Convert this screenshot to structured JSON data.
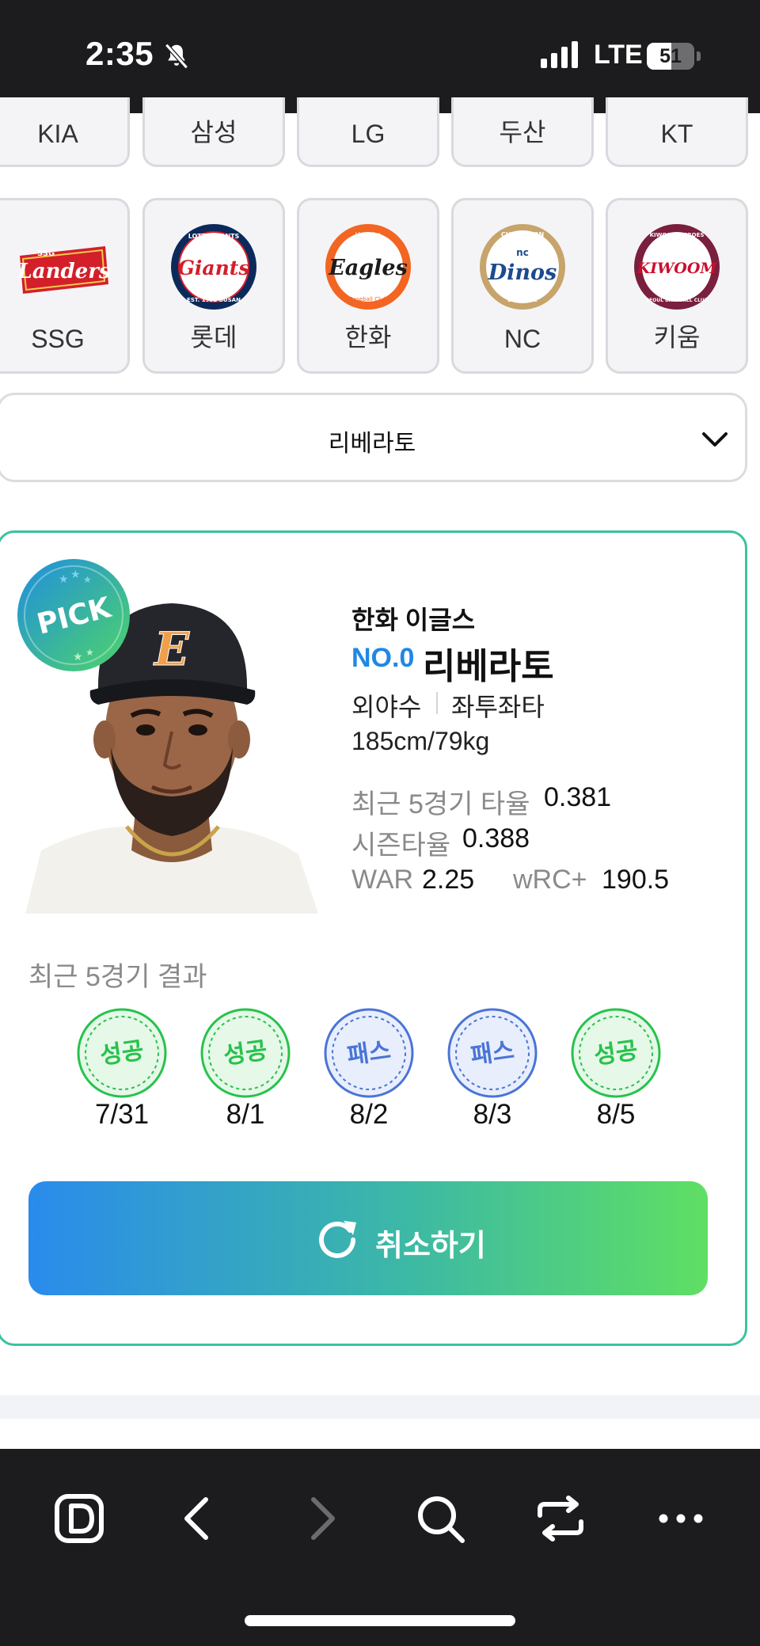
{
  "status_bar": {
    "time": "2:35",
    "network": "LTE",
    "battery": "51",
    "icons": [
      "bell-slash-icon",
      "signal-icon",
      "battery-icon"
    ]
  },
  "teams": {
    "row1": [
      "KIA",
      "삼성",
      "LG",
      "두산",
      "KT"
    ],
    "row2": [
      {
        "name": "SSG",
        "logo": "ssg-landers-logo",
        "logo_text": "Landers"
      },
      {
        "name": "롯데",
        "logo": "lotte-giants-logo",
        "logo_text": "Giants"
      },
      {
        "name": "한화",
        "logo": "hanwha-eagles-logo",
        "logo_text": "Eagles"
      },
      {
        "name": "NC",
        "logo": "nc-dinos-logo",
        "logo_text": "Dinos"
      },
      {
        "name": "키움",
        "logo": "kiwoom-heroes-logo",
        "logo_text": "KIWOOM"
      }
    ]
  },
  "player_select": {
    "value": "리베라토"
  },
  "player_card": {
    "badge": "PICK",
    "team": "한화 이글스",
    "number": "NO.0",
    "name": "리베라토",
    "position": "외야수",
    "handedness": "좌투좌타",
    "body": "185cm/79kg",
    "stats": {
      "recent5_label": "최근 5경기 타율",
      "recent5_value": "0.381",
      "season_label": "시즌타율",
      "season_value": "0.388",
      "war_label": "WAR",
      "war_value": "2.25",
      "wrc_label": "wRC+",
      "wrc_value": "190.5"
    },
    "recent_title": "최근 5경기 결과",
    "results": [
      {
        "label": "성공",
        "date": "7/31",
        "status": "success"
      },
      {
        "label": "성공",
        "date": "8/1",
        "status": "success"
      },
      {
        "label": "패스",
        "date": "8/2",
        "status": "pass"
      },
      {
        "label": "패스",
        "date": "8/3",
        "status": "pass"
      },
      {
        "label": "성공",
        "date": "8/5",
        "status": "success"
      }
    ],
    "cancel_label": "취소하기"
  },
  "colors": {
    "accent_blue": "#1e88e5",
    "card_border": "#3ac2a0",
    "success_green": "#27c24c",
    "pass_blue": "#4a74d6",
    "button_gradient": [
      "#2a8bec",
      "#3cb8a6",
      "#5fdf63"
    ]
  },
  "bottom_bar": {
    "items": [
      "d-app-icon",
      "back-icon",
      "forward-icon",
      "search-icon",
      "tabs-icon",
      "more-icon"
    ]
  }
}
